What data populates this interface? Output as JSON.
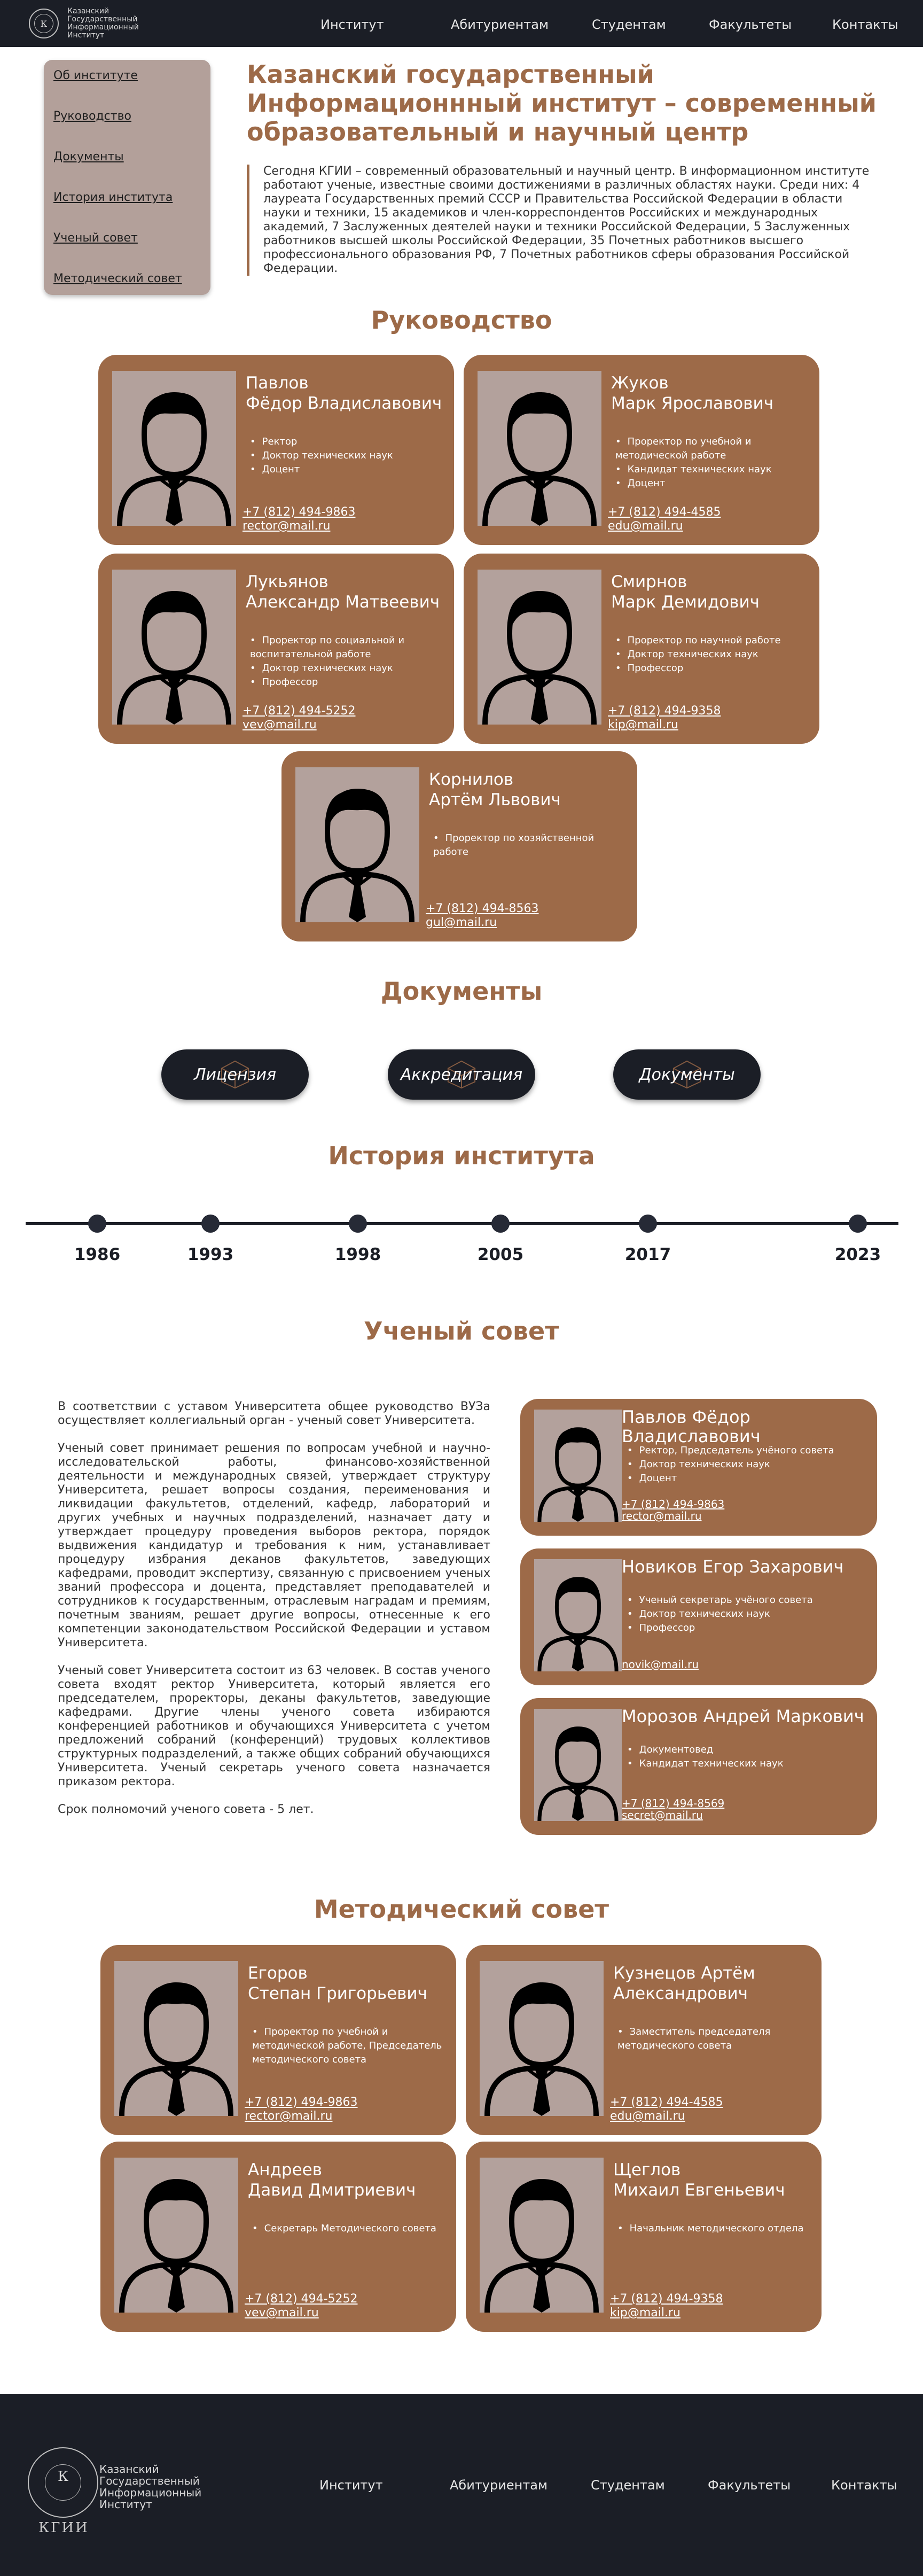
{
  "header": {
    "logo_text": "Казанский Государственный Информационный Институт",
    "nav": [
      "Институт",
      "Абитуриентам",
      "Студентам",
      "Факультеты",
      "Контакты"
    ]
  },
  "sidebar": {
    "items": [
      "Об институте",
      "Руководство",
      "Документы",
      "История института",
      "Ученый совет",
      "Методический совет"
    ]
  },
  "intro": {
    "title": "Казанский государственный Информационнный институт  – современный образовательный и научный центр",
    "lead": "Сегодня КГИИ – современный образовательный и научный центр. В информационном институте работают ученые, известные своими достижениями в различных областях науки. Среди них: 4 лауреата Государственных премий СССР и Правительства Российской Федерации в области науки и техники, 15 академиков и член-корреспондентов Российских и международных академий, 7 Заслуженных деятелей науки и техники Российской Федерации, 5 Заслуженных работников высшей школы Российской Федерации, 35 Почетных работников высшего профессионального образования РФ, 7 Почетных работников сферы образования Российской Федерации."
  },
  "sections": {
    "leadership": "Руководство",
    "documents": "Документы",
    "history": "История института",
    "council": "Ученый совет",
    "method": "Методический совет"
  },
  "leadership": [
    {
      "name1": "Павлов",
      "name2": "Фёдор Владиславович",
      "roles": [
        "Ректор",
        "Доктор технических наук",
        "Доцент"
      ],
      "phone": "+7 (812) 494-9863",
      "email": "rector@mail.ru"
    },
    {
      "name1": "Жуков",
      "name2": "Марк Ярославович",
      "roles": [
        "Проректор по учебной и методической работе",
        "Кандидат технических наук",
        "Доцент"
      ],
      "phone": "+7 (812) 494-4585",
      "email": "edu@mail.ru"
    },
    {
      "name1": "Лукьянов",
      "name2": "Александр Матвеевич",
      "roles": [
        "Проректор по социальной и воспитательной работе",
        "Доктор технических наук",
        "Профессор"
      ],
      "phone": "+7 (812) 494-5252",
      "email": "vev@mail.ru"
    },
    {
      "name1": "Смирнов",
      "name2": "Марк Демидович",
      "roles": [
        "Проректор по научной работе",
        "Доктор технических наук",
        "Профессор"
      ],
      "phone": "+7 (812) 494-9358",
      "email": "kip@mail.ru"
    },
    {
      "name1": "Корнилов",
      "name2": "Артём Львович",
      "roles": [
        "Проректор по хозяйственной работе"
      ],
      "phone": "+7 (812) 494-8563",
      "email": "gul@mail.ru"
    }
  ],
  "documents": [
    "Лицензия",
    "Аккредитация",
    "Документы"
  ],
  "history": {
    "years": [
      "1986",
      "1993",
      "1998",
      "2005",
      "2017",
      "2023"
    ]
  },
  "council": {
    "paragraphs": [
      "В соответствии с уставом Университета общее руководство ВУЗа осуществляет коллегиальный орган - ученый совет Университета.",
      "Ученый совет принимает решения по вопросам учебной и научно-исследовательской работы, финансово-хозяйственной деятельности и международных связей, утверждает структуру Университета, решает вопросы создания, переименования и ликвидации факультетов, отделений, кафедр, лабораторий и других учебных и научных подразделений, назначает дату и утверждает процедуру проведения выборов ректора, порядок выдвижения кандидатур и требования к ним, устанавливает процедуру избрания деканов факультетов, заведующих кафедрами, проводит экспертизу, связанную с присвоением ученых званий профессора и доцента, представляет преподавателей и сотрудников к государственным, отраслевым наградам и премиям, почетным званиям, решает другие вопросы, отнесенные к его компетенции законодательством Российской Федерации и уставом Университета.",
      "Ученый совет Университета состоит из 63 человек. В состав ученого совета входят ректор Университета, который является его председателем, проректоры, деканы факультетов, заведующие кафедрами. Другие члены ученого совета избираются конференцией работников и обучающихся Университета с учетом предложений собраний (конференций) трудовых коллективов структурных подразделений, а также общих собраний обучающихся Университета. Ученый секретарь ученого совета назначается приказом ректора.",
      "Срок полномочий ученого совета - 5 лет."
    ],
    "members": [
      {
        "name": "Павлов Фёдор Владиславович",
        "roles": [
          "Ректор, Председатель учёного совета",
          "Доктор технических наук",
          "Доцент"
        ],
        "phone": "+7 (812) 494-9863",
        "email": "rector@mail.ru"
      },
      {
        "name": "Новиков Егор Захарович",
        "roles": [
          "Ученый секретарь учёного совета",
          "Доктор технических наук",
          "Профессор"
        ],
        "phone": "",
        "email": "novik@mail.ru"
      },
      {
        "name": "Морозов Андрей Маркович",
        "roles": [
          "Документовед",
          "Кандидат технических наук"
        ],
        "phone": "+7 (812) 494-8569",
        "email": "secret@mail.ru"
      }
    ]
  },
  "method": [
    {
      "name1": "Егоров",
      "name2": "Степан Григорьевич",
      "roles": [
        "Проректор по учебной и методической работе, Председатель методического совета"
      ],
      "phone": "+7 (812) 494-9863",
      "email": "rector@mail.ru"
    },
    {
      "name1": "Кузнецов Артём",
      "name2": "Александрович",
      "roles": [
        "Заместитель председателя методического совета"
      ],
      "phone": "+7 (812) 494-4585",
      "email": "edu@mail.ru"
    },
    {
      "name1": "Андреев",
      "name2": "Давид Дмитриевич",
      "roles": [
        "Секретарь Методического совета"
      ],
      "phone": "+7 (812) 494-5252",
      "email": "vev@mail.ru"
    },
    {
      "name1": "Щеглов",
      "name2": "Михаил Евгеньевич",
      "roles": [
        "Начальник методического отдела"
      ],
      "phone": "+7 (812) 494-9358",
      "email": "kip@mail.ru"
    }
  ],
  "footer": {
    "logo_text": "Казанский Государственный Информационный Институт",
    "logo_abbr": "КГИИ",
    "logo_seal": "К",
    "nav": [
      "Институт",
      "Абитуриентам",
      "Студентам",
      "Факультеты",
      "Контакты"
    ]
  }
}
